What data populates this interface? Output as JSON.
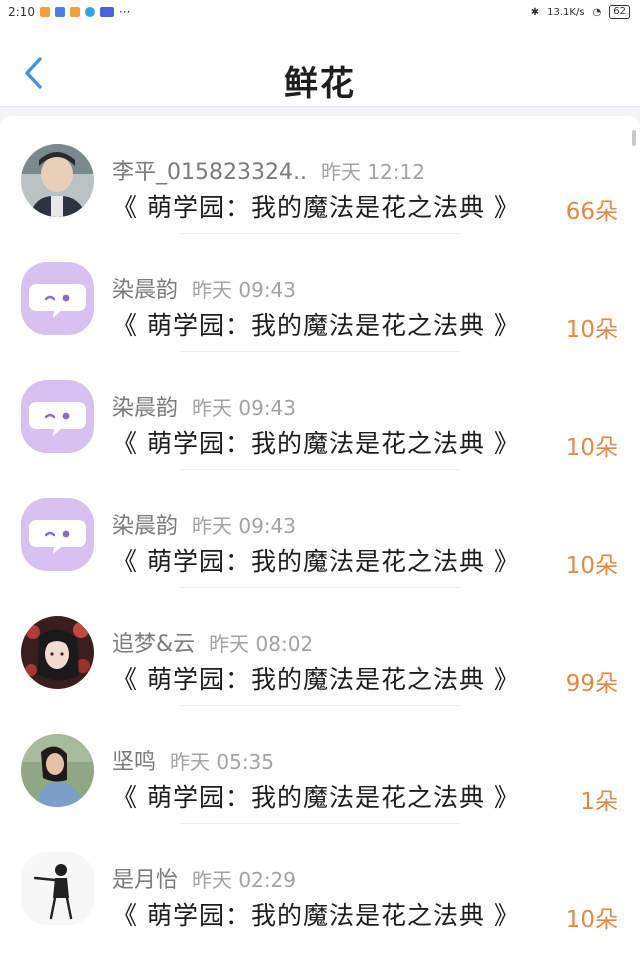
{
  "status_bar": {
    "time": "2:10",
    "more": "···",
    "network_speed": "13.1K/s",
    "battery": "62"
  },
  "header": {
    "title": "鲜花"
  },
  "colors": {
    "accent": "#3d94e0",
    "count": "#e08a44",
    "default_avatar": "#d6c1f0"
  },
  "rows": [
    {
      "user": "李平_015823324..",
      "time": "昨天 12:12",
      "book": "《 萌学园：我的魔法是花之法典 》",
      "count": "66朵",
      "avatar": "photo-girl"
    },
    {
      "user": "染晨韵",
      "time": "昨天 09:43",
      "book": "《 萌学园：我的魔法是花之法典 》",
      "count": "10朵",
      "avatar": "default-chat"
    },
    {
      "user": "染晨韵",
      "time": "昨天 09:43",
      "book": "《 萌学园：我的魔法是花之法典 》",
      "count": "10朵",
      "avatar": "default-chat"
    },
    {
      "user": "染晨韵",
      "time": "昨天 09:43",
      "book": "《 萌学园：我的魔法是花之法典 》",
      "count": "10朵",
      "avatar": "default-chat"
    },
    {
      "user": "追梦&云",
      "time": "昨天 08:02",
      "book": "《 萌学园：我的魔法是花之法典 》",
      "count": "99朵",
      "avatar": "anime-girl"
    },
    {
      "user": "坚鸣",
      "time": "昨天 05:35",
      "book": "《 萌学园：我的魔法是花之法典 》",
      "count": "1朵",
      "avatar": "photo-woman"
    },
    {
      "user": "是月怡",
      "time": "昨天 02:29",
      "book": "《 萌学园：我的魔法是花之法典 》",
      "count": "10朵",
      "avatar": "sketch-figure"
    }
  ]
}
